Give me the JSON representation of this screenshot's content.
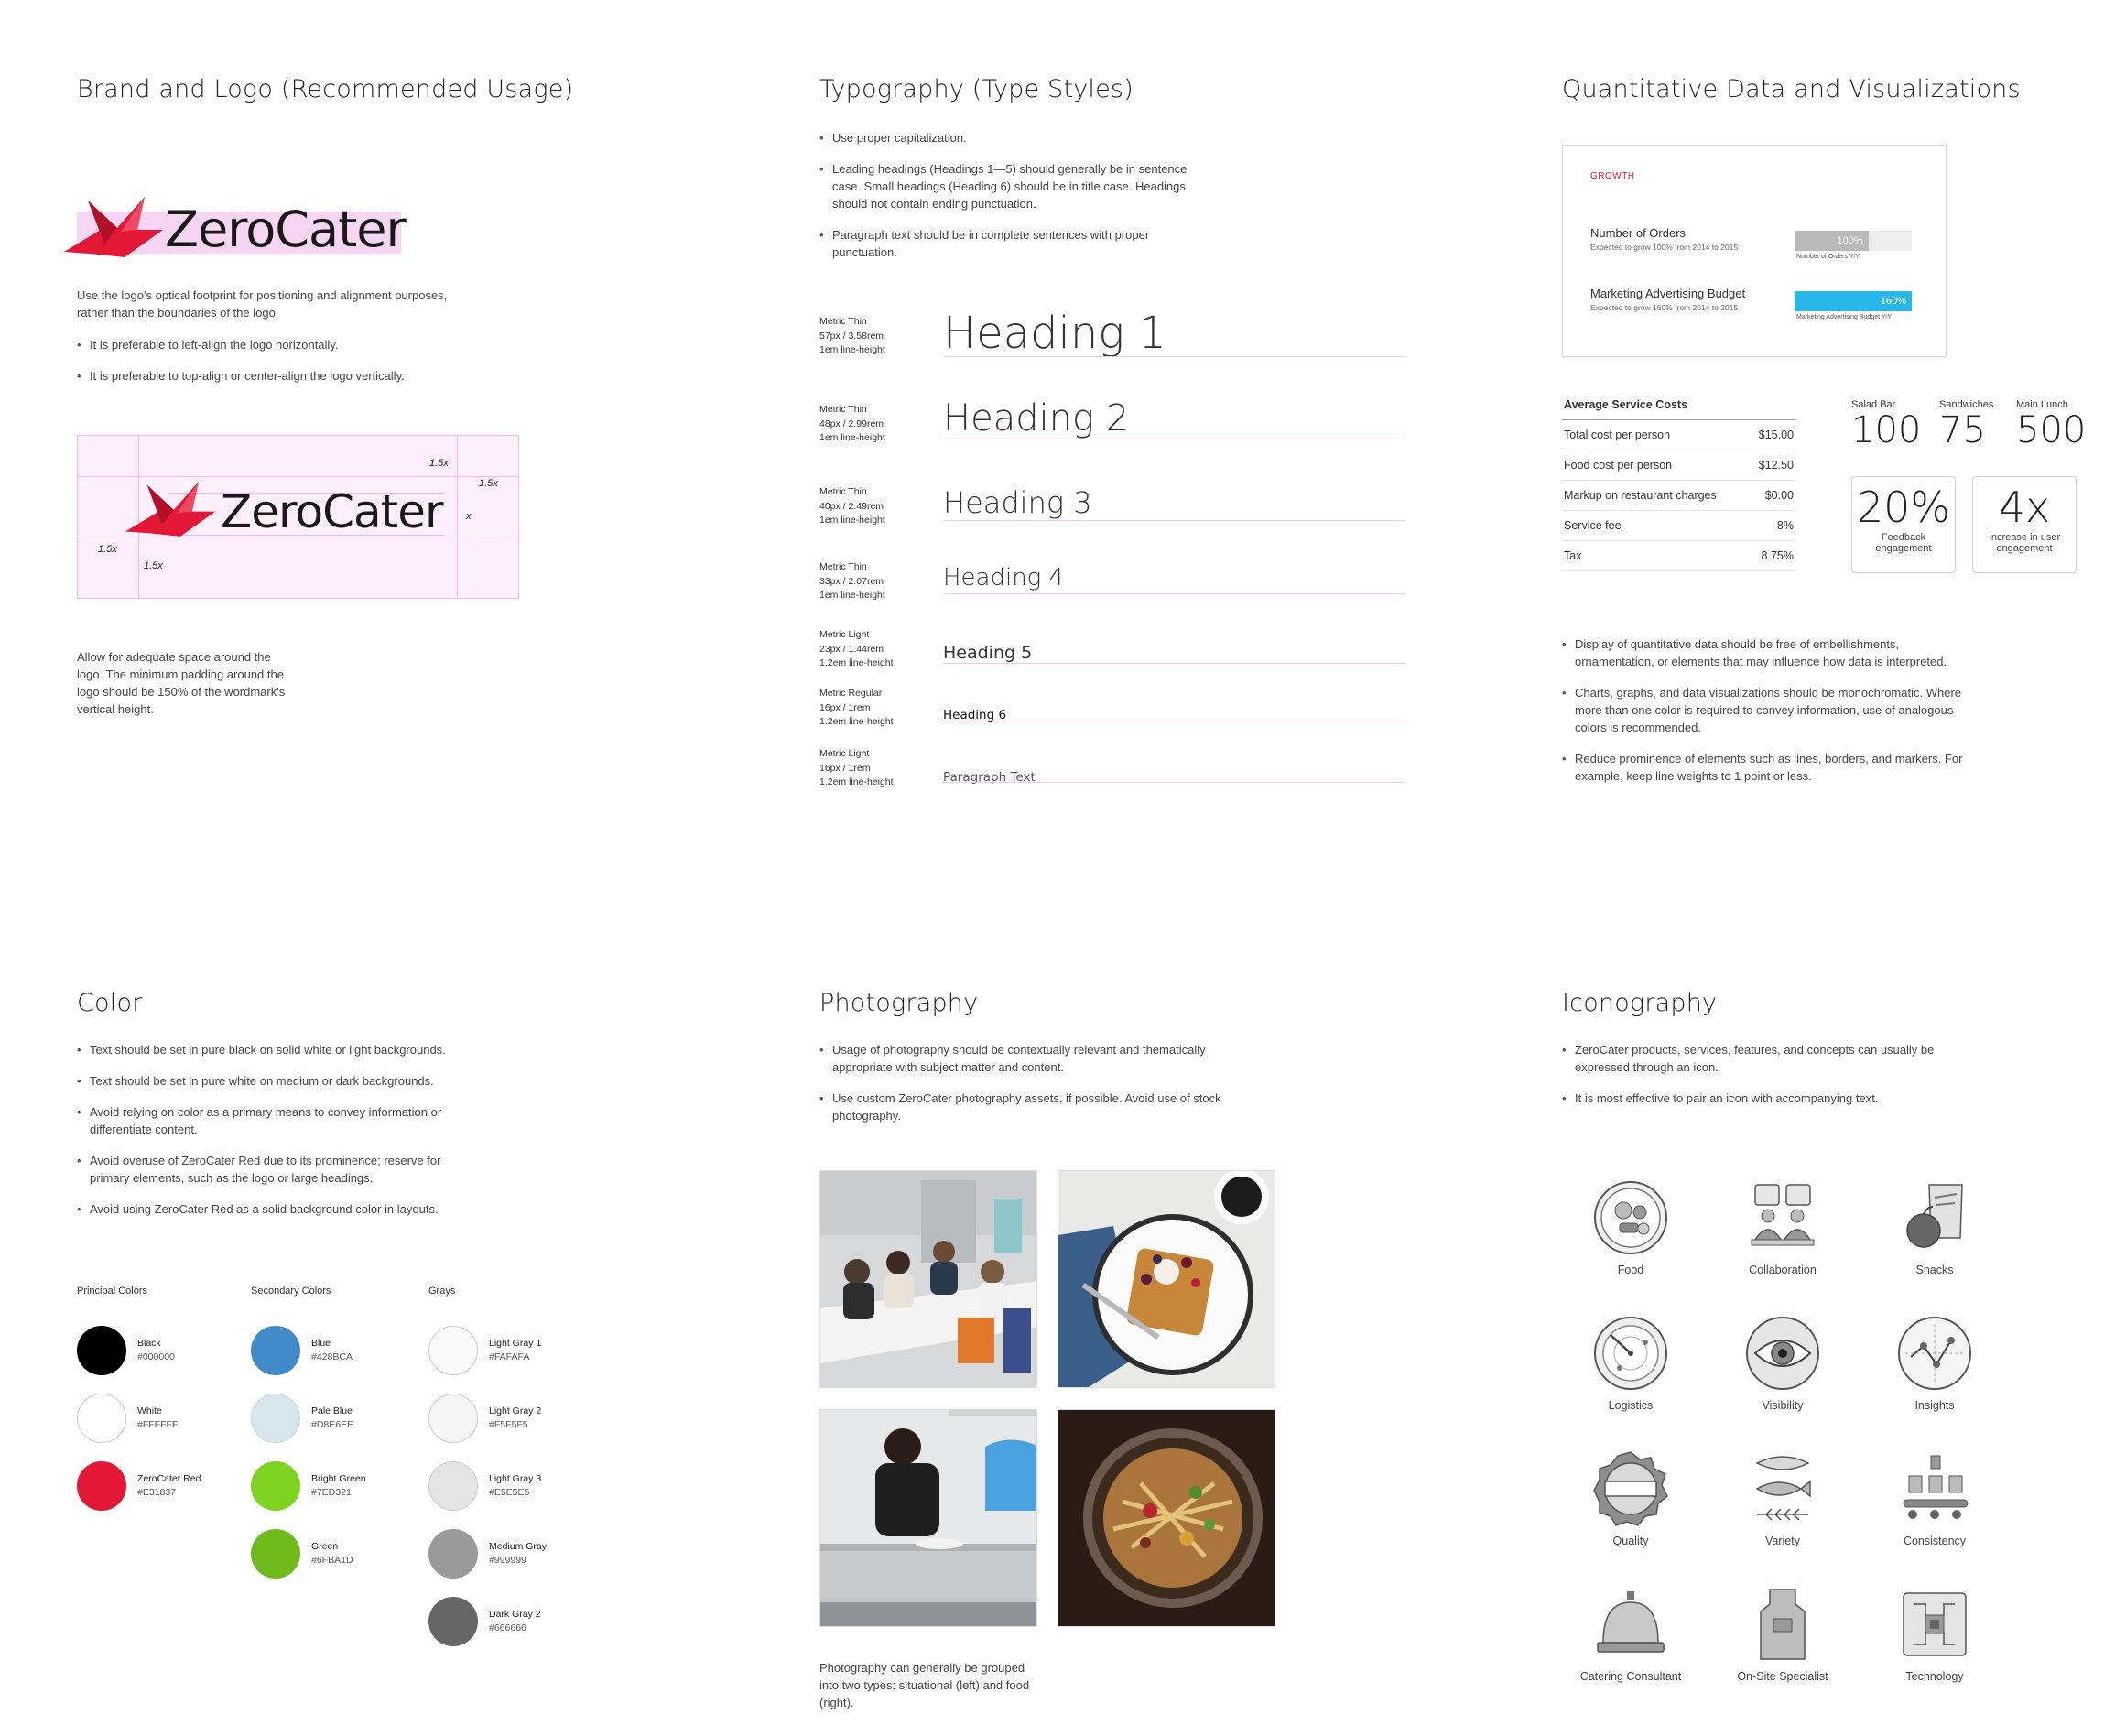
{
  "brand": {
    "title": "Brand and Logo (Recommended Usage)",
    "wordmark": "ZeroCater",
    "intro": "Use the logo's optical footprint for positioning and alignment purposes, rather than the boundaries of the logo.",
    "bullets": [
      "It is preferable to left-align the logo horizontally.",
      "It is preferable to top-align or center-align the logo vertically."
    ],
    "spacing_labels": {
      "top_right": "1.5x",
      "right": "1.5x",
      "left": "1.5x",
      "bottom": "1.5x",
      "x_height": "x"
    },
    "padding_note": "Allow for adequate space around the logo. The minimum padding around the logo should be 150% of the wordmark's vertical height."
  },
  "typography": {
    "title": "Typography (Type Styles)",
    "bullets": [
      "Use proper capitalization.",
      "Leading headings (Headings 1—5) should generally be in sentence case. Small headings (Heading 6) should be in title case. Headings should not contain ending punctuation.",
      "Paragraph text should be in complete sentences with proper punctuation."
    ],
    "styles": [
      {
        "font": "Metric Thin",
        "size": "57px / 3.58rem",
        "lh": "1em line-height",
        "sample": "Heading 1"
      },
      {
        "font": "Metric Thin",
        "size": "48px / 2.99rem",
        "lh": "1em line-height",
        "sample": "Heading 2"
      },
      {
        "font": "Metric Thin",
        "size": "40px / 2.49rem",
        "lh": "1em line-height",
        "sample": "Heading 3"
      },
      {
        "font": "Metric Thin",
        "size": "33px / 2.07rem",
        "lh": "1em line-height",
        "sample": "Heading 4"
      },
      {
        "font": "Metric Light",
        "size": "23px / 1.44rem",
        "lh": "1.2em line-height",
        "sample": "Heading 5"
      },
      {
        "font": "Metric Regular",
        "size": "16px / 1rem",
        "lh": "1.2em line-height",
        "sample": "Heading 6"
      },
      {
        "font": "Metric Light",
        "size": "16px / 1rem",
        "lh": "1.2em line-height",
        "sample": "Paragraph Text"
      }
    ]
  },
  "quant": {
    "title": "Quantitative Data and Visualizations",
    "growth_label": "GROWTH",
    "bars": [
      {
        "name": "Number of Orders",
        "sub": "Expected to grow 100% from 2014 to 2015",
        "value": "100%",
        "fill": 0.63,
        "legend": "Number of Orders Y/Y",
        "color": "#b9b9b9"
      },
      {
        "name": "Marketing Advertising Budget",
        "sub": "Expected to grow 160% from 2014 to 2015",
        "value": "160%",
        "fill": 1.0,
        "legend": "Marketing Advertising Budget Y/Y",
        "color": "#29b6e8"
      }
    ],
    "table": {
      "header": "Average Service Costs",
      "rows": [
        {
          "label": "Total cost per person",
          "value": "$15.00"
        },
        {
          "label": "Food cost per person",
          "value": "$12.50"
        },
        {
          "label": "Markup on restaurant charges",
          "value": "$0.00"
        },
        {
          "label": "Service fee",
          "value": "8%"
        },
        {
          "label": "Tax",
          "value": "8.75%"
        }
      ]
    },
    "stats": [
      {
        "label": "Salad Bar",
        "value": "100"
      },
      {
        "label": "Sandwiches",
        "value": "75"
      },
      {
        "label": "Main Lunch",
        "value": "500"
      }
    ],
    "kpis": [
      {
        "value": "20%",
        "label": "Feedback engagement"
      },
      {
        "value": "4x",
        "label": "Increase in user engagement"
      }
    ],
    "bullets": [
      "Display of quantitative data should be free of embellishments, ornamentation, or elements that may influence how data is interpreted.",
      "Charts, graphs, and data visualizations should be monochromatic. Where more than one color is required to convey information, use of analogous colors is recommended.",
      "Reduce prominence of elements such as lines, borders, and markers. For example, keep line weights to 1 point or less."
    ]
  },
  "color": {
    "title": "Color",
    "bullets": [
      "Text should be set in pure black on solid white or light backgrounds.",
      "Text should be set in pure white on medium or dark backgrounds.",
      "Avoid relying on color as a primary means to convey information or differentiate content.",
      "Avoid overuse of ZeroCater Red due to its prominence; reserve for primary elements, such as the logo or large headings.",
      "Avoid using ZeroCater Red as a solid background color in layouts."
    ],
    "groups": [
      {
        "title": "Principal Colors",
        "swatches": [
          {
            "name": "Black",
            "hex": "#000000"
          },
          {
            "name": "White",
            "hex": "#FFFFFF"
          },
          {
            "name": "ZeroCater Red",
            "hex": "#E31837"
          }
        ]
      },
      {
        "title": "Secondary Colors",
        "swatches": [
          {
            "name": "Blue",
            "hex": "#428BCA"
          },
          {
            "name": "Pale Blue",
            "hex": "#D8E6EE"
          },
          {
            "name": "Bright Green",
            "hex": "#7ED321"
          },
          {
            "name": "Green",
            "hex": "#6FBA1D"
          }
        ]
      },
      {
        "title": "Grays",
        "swatches": [
          {
            "name": "Light Gray 1",
            "hex": "#FAFAFA"
          },
          {
            "name": "Light Gray 2",
            "hex": "#F5F5F5"
          },
          {
            "name": "Light Gray 3",
            "hex": "#E5E5E5"
          },
          {
            "name": "Medium Gray",
            "hex": "#999999"
          },
          {
            "name": "Dark Gray 2",
            "hex": "#666666"
          }
        ]
      }
    ]
  },
  "photo": {
    "title": "Photography",
    "bullets": [
      "Usage of photography should be contextually relevant and thematically appropriate with subject matter and content.",
      "Use custom ZeroCater photography assets, if possible. Avoid use of stock photography."
    ],
    "caption": "Photography can generally be grouped into two types: situational (left) and food (right)."
  },
  "icons": {
    "title": "Iconography",
    "bullets": [
      "ZeroCater products, services, features, and concepts can usually be expressed through an icon.",
      "It is most effective to pair an icon with accompanying text."
    ],
    "items": [
      {
        "label": "Food",
        "icon": "food-icon"
      },
      {
        "label": "Collaboration",
        "icon": "collaboration-icon"
      },
      {
        "label": "Snacks",
        "icon": "snacks-icon"
      },
      {
        "label": "Logistics",
        "icon": "logistics-icon"
      },
      {
        "label": "Visibility",
        "icon": "visibility-icon"
      },
      {
        "label": "Insights",
        "icon": "insights-icon"
      },
      {
        "label": "Quality",
        "icon": "quality-icon"
      },
      {
        "label": "Variety",
        "icon": "variety-icon"
      },
      {
        "label": "Consistency",
        "icon": "consistency-icon"
      },
      {
        "label": "Catering Consultant",
        "icon": "catering-consultant-icon"
      },
      {
        "label": "On-Site Specialist",
        "icon": "on-site-specialist-icon"
      },
      {
        "label": "Technology",
        "icon": "technology-icon"
      }
    ]
  },
  "colors": {
    "brand_red": "#E31837",
    "guide_pink": "#F4B6F0"
  }
}
